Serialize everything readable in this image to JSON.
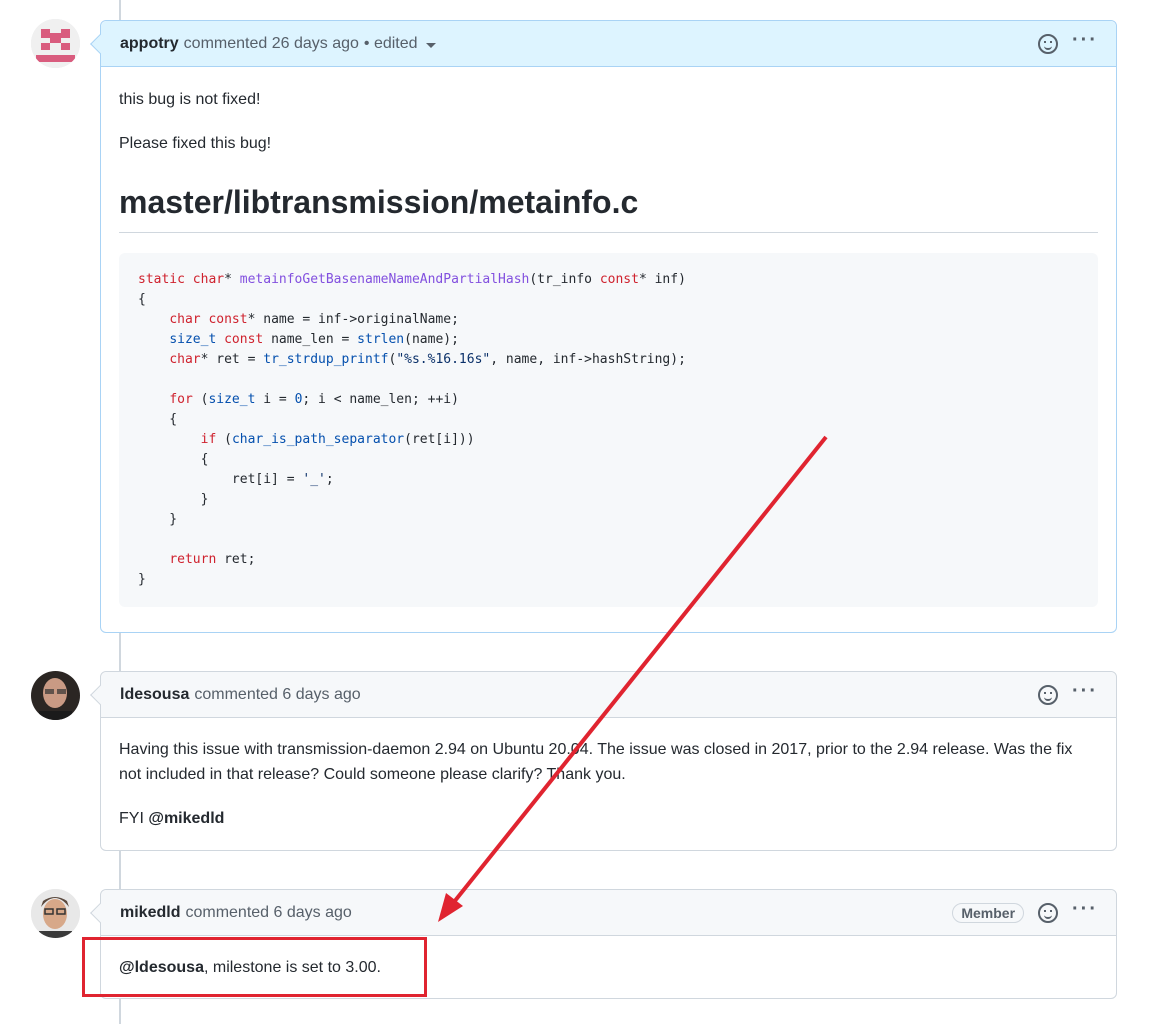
{
  "comments": [
    {
      "author": "appotry",
      "meta": "commented 26 days ago",
      "edited": "• edited",
      "paragraphs": [
        "this bug is not fixed!",
        "Please fixed this bug!"
      ],
      "heading": "master/libtransmission/metainfo.c"
    },
    {
      "author": "ldesousa",
      "meta": "commented 6 days ago",
      "paragraph": "Having this issue with transmission-daemon 2.94 on Ubuntu 20.04. The issue was closed in 2017, prior to the 2.94 release. Was the fix not included in that release? Could someone please clarify? Thank you.",
      "fyi": "FYI",
      "fyi_mention": "@mikedld"
    },
    {
      "author": "mikedld",
      "meta": "commented 6 days ago",
      "badge": "Member",
      "mention": "@ldesousa",
      "text": ", milestone is set to 3.00."
    }
  ],
  "actions": {
    "dots": "···"
  },
  "icons": [
    "smiley-icon",
    "kebab-menu-icon",
    "caret-down-icon"
  ],
  "colors": {
    "annotation": "#e02430",
    "own_comment_header": "#ddf4ff"
  }
}
